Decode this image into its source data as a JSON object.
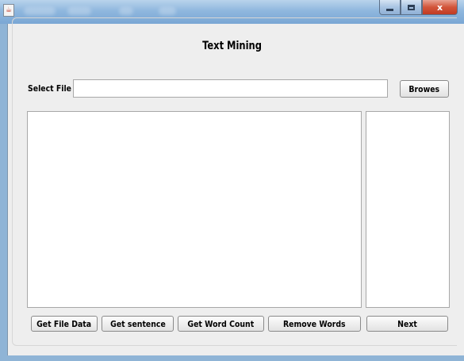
{
  "window": {
    "controls": {
      "minimize_icon": "minimize-icon",
      "maximize_icon": "maximize-icon",
      "close_label": "x"
    }
  },
  "main": {
    "title": "Text Mining",
    "file_selector": {
      "label": "Select File",
      "value": "",
      "browse_label": "Browes"
    },
    "actions": {
      "get_file_data": "Get File Data",
      "get_sentence": "Get sentence",
      "get_word_count": "Get Word Count",
      "remove_words": "Remove Words",
      "next": "Next"
    }
  },
  "colors": {
    "titlebar": "#8fb7de",
    "client_bg": "#eeeeee",
    "close_button": "#c23a22"
  }
}
